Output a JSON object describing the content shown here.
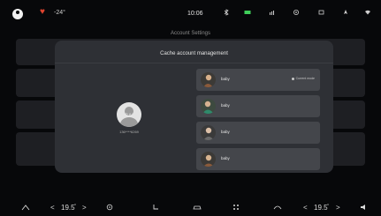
{
  "status_bar": {
    "temperature": "-24°",
    "time": "10:06"
  },
  "page": {
    "title": "Account Settings"
  },
  "modal": {
    "title": "Cache account management",
    "user": {
      "name": "SAI",
      "phone": "136****6269"
    },
    "accounts": [
      {
        "label": "baby",
        "current_label": "Current mode"
      },
      {
        "label": "baby"
      },
      {
        "label": "baby"
      },
      {
        "label": "baby"
      }
    ]
  },
  "bottom_bar": {
    "left_temp": "19.5",
    "right_temp": "19.5"
  },
  "colors": {
    "accent_red": "#e0442f",
    "modal_bg": "#2e3035",
    "item_bg": "#44464b"
  },
  "icons": [
    "user-icon",
    "heart-icon",
    "cloud-icon",
    "bluetooth-icon",
    "battery-icon",
    "signal-icon",
    "target-icon",
    "wifi-icon",
    "fan-icon",
    "seat-icon",
    "car-icon",
    "grid-icon",
    "recirc-icon",
    "volume-icon"
  ]
}
